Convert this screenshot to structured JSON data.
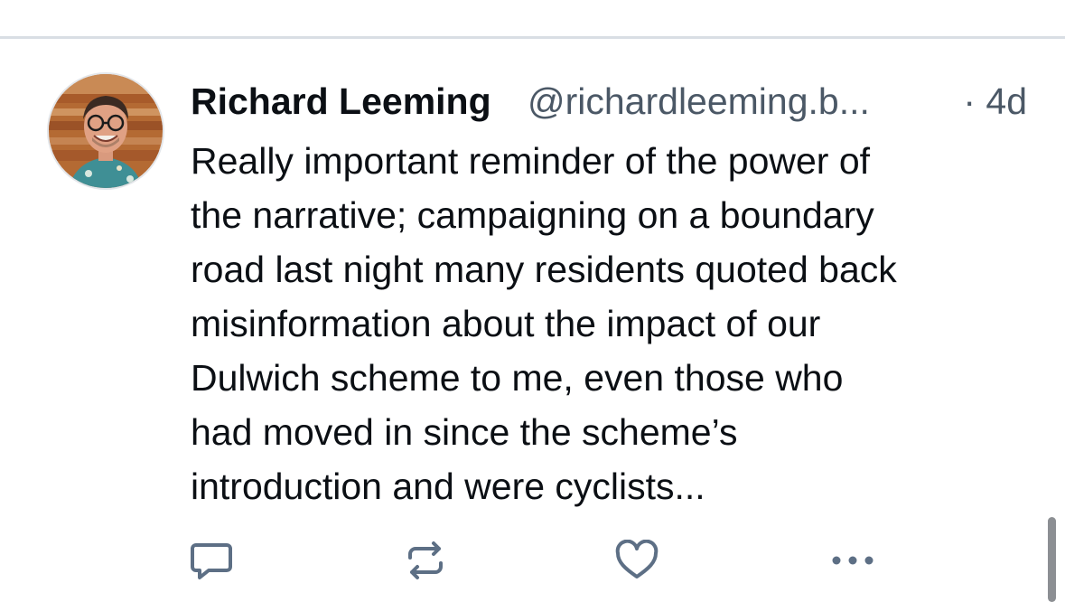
{
  "post": {
    "author_name": "Richard Leeming",
    "author_handle": "@richardleeming.b...",
    "time_ago": "· 4d",
    "text_lines": [
      "Really important reminder of the power of",
      "the narrative; campaigning on a boundary",
      "road last night many residents quoted back",
      "misinformation about the impact of our",
      "Dulwich scheme to me, even those who",
      "had moved in since the scheme’s",
      "introduction and were cyclists..."
    ]
  },
  "actions": {
    "reply_icon": "reply-icon",
    "repost_icon": "repost-icon",
    "like_icon": "like-icon",
    "more_icon": "more-icon"
  },
  "colors": {
    "text": "#0b0f14",
    "muted": "#4b5866",
    "icon": "#5d6f85",
    "divider": "#d9dee4",
    "scrollbar": "#8c8f93"
  }
}
